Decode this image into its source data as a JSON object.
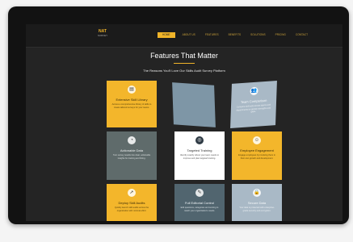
{
  "site": {
    "logo_text": "NAT",
    "logo_subtext": "SURVEY"
  },
  "nav": [
    {
      "label": "Home",
      "active": true
    },
    {
      "label": "About Us",
      "active": false
    },
    {
      "label": "Features",
      "active": false
    },
    {
      "label": "Benefits",
      "active": false
    },
    {
      "label": "Solutions",
      "active": false
    },
    {
      "label": "Pricing",
      "active": false
    },
    {
      "label": "Contact",
      "active": false
    }
  ],
  "hero": {
    "title": "Features That Matter",
    "subtitle": "The Reasons You'll Love Our Skills Audit Survey Platform"
  },
  "cards": [
    {
      "title": "Extensive Skill Library",
      "desc": "Access a comprehensive library of skills to create tailored surveys for your teams.",
      "icon": "book-icon"
    },
    {
      "title": "",
      "desc": "",
      "icon": ""
    },
    {
      "title": "Team Comparison",
      "desc": "Compare skill sets across teams and departments to identify strengths and gaps.",
      "icon": "team-icon"
    },
    {
      "title": "Actionable Data",
      "desc": "Turn survey results into clear, actionable insights for training and hiring.",
      "icon": "chart-icon"
    },
    {
      "title": "Targeted Training",
      "desc": "Identify exactly where your team needs to improve and plan targeted training.",
      "icon": "target-icon"
    },
    {
      "title": "Employee Engagement",
      "desc": "Engage employees by involving them in their own growth and development.",
      "icon": "people-icon"
    },
    {
      "title": "Deploy Skill Audits",
      "desc": "Quickly launch skill audits across the organization with minimal effort.",
      "icon": "rocket-icon"
    },
    {
      "title": "Full Editorial Control",
      "desc": "Edit questions, categories and scoring to match your organization's needs.",
      "icon": "edit-icon"
    },
    {
      "title": "Secure Data",
      "desc": "Your data is protected with enterprise-grade security and encryption.",
      "icon": "lock-icon"
    }
  ]
}
